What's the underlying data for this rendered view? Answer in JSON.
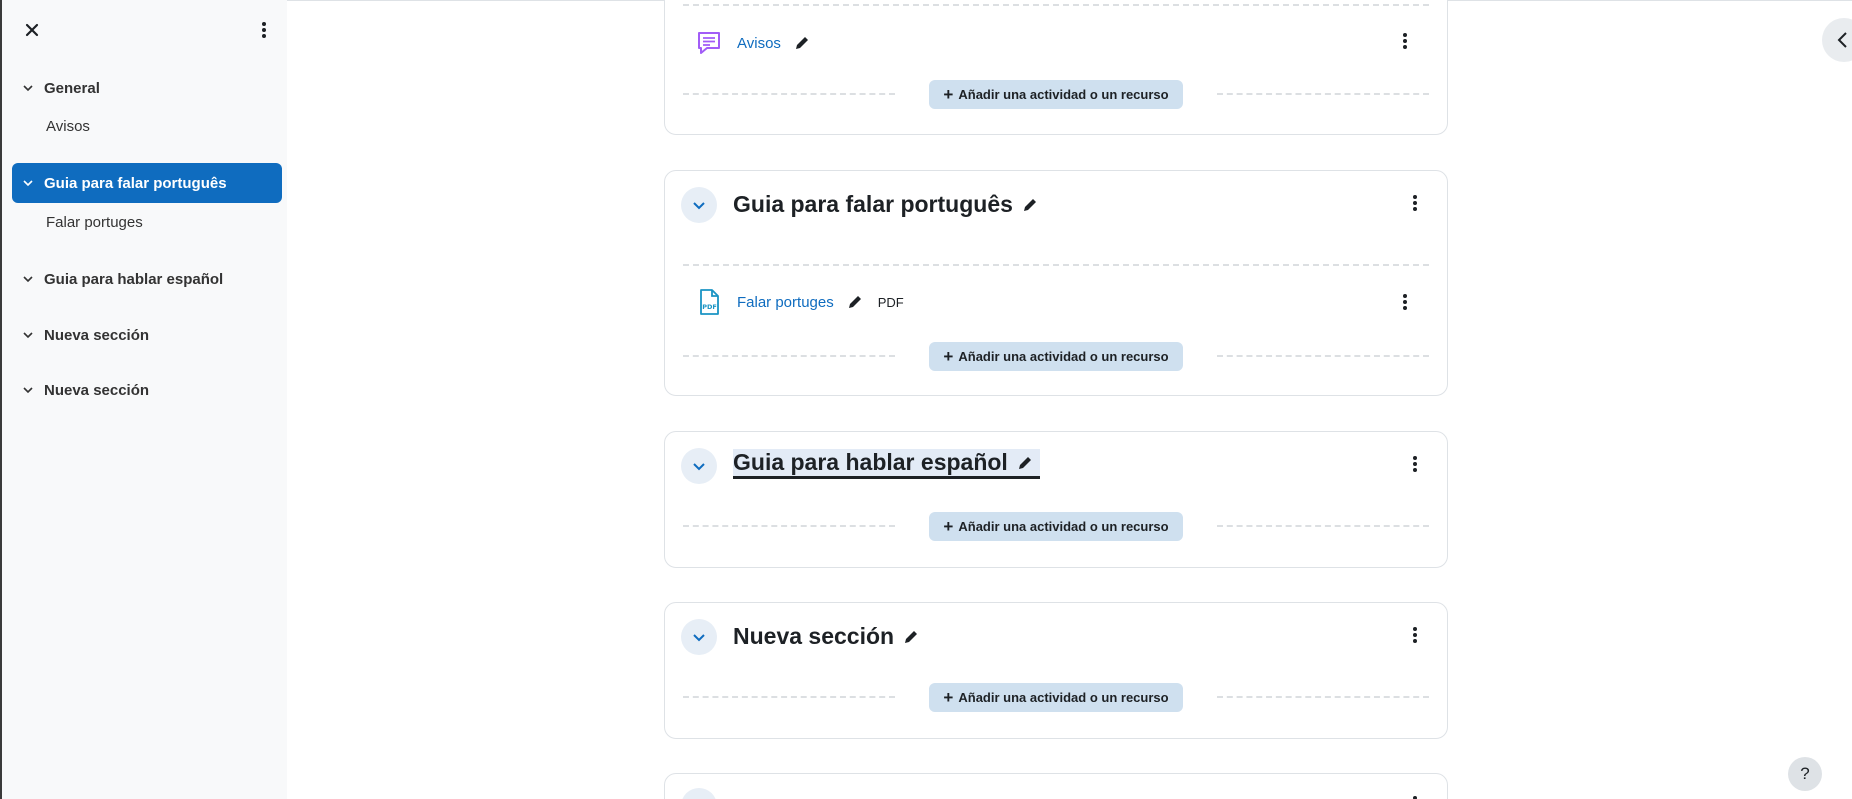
{
  "sidebar": {
    "sections": [
      {
        "label": "General",
        "items": [
          "Avisos"
        ]
      },
      {
        "label": "Guia para falar português",
        "items": [
          "Falar portuges"
        ],
        "active": true
      },
      {
        "label": "Guia para hablar español",
        "items": []
      },
      {
        "label": "Nueva sección",
        "items": []
      },
      {
        "label": "Nueva sección",
        "items": []
      }
    ]
  },
  "main": {
    "add_label": "Añadir una actividad o un recurso",
    "cards": [
      {
        "title": "",
        "activities": [
          {
            "name": "Avisos",
            "icon": "forum-icon",
            "tag": ""
          }
        ]
      },
      {
        "title": "Guia para falar português",
        "activities": [
          {
            "name": "Falar portuges",
            "icon": "pdf-file-icon",
            "tag": "PDF"
          }
        ]
      },
      {
        "title": "Guia para hablar español",
        "activities": []
      },
      {
        "title": "Nueva sección",
        "activities": []
      }
    ]
  },
  "help": {
    "label": "?"
  },
  "colors": {
    "accent": "#0f6cbf",
    "add_button": "#cfe0ef",
    "forum_icon": "#a25df7",
    "pdf_icon": "#1a94c4"
  }
}
